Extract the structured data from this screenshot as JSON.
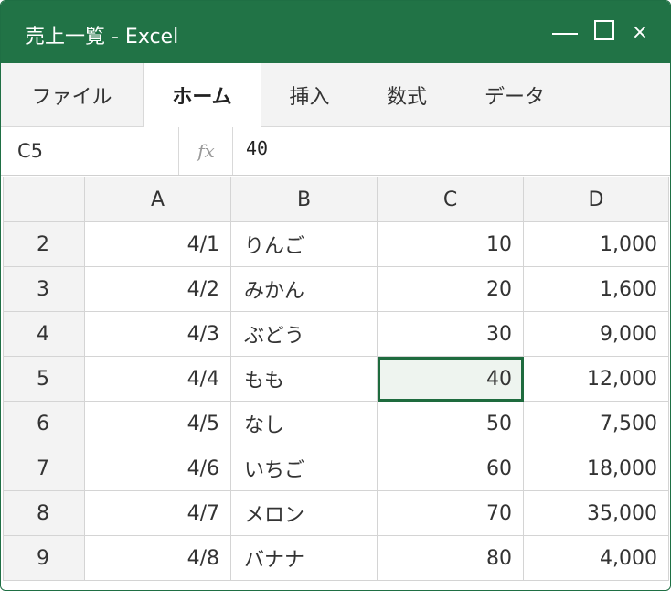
{
  "window": {
    "title": "売上一覧 - Excel",
    "accent_color": "#217346",
    "minimize_icon": "minimize-icon",
    "maximize_icon": "maximize-icon",
    "close_icon": "close-icon",
    "close_glyph": "×"
  },
  "ribbon": {
    "tabs": [
      {
        "label": "ファイル",
        "active": false
      },
      {
        "label": "ホーム",
        "active": true
      },
      {
        "label": "挿入",
        "active": false
      },
      {
        "label": "数式",
        "active": false
      },
      {
        "label": "データ",
        "active": false
      }
    ]
  },
  "formula_bar": {
    "name_box": "C5",
    "fx_label": "fx",
    "value": "40"
  },
  "sheet": {
    "columns": [
      "A",
      "B",
      "C",
      "D"
    ],
    "selected_cell": "C5",
    "rows": [
      {
        "row": "2",
        "a": "4/1",
        "b": "りんご",
        "c": "10",
        "d": "1,000"
      },
      {
        "row": "3",
        "a": "4/2",
        "b": "みかん",
        "c": "20",
        "d": "1,600"
      },
      {
        "row": "4",
        "a": "4/3",
        "b": "ぶどう",
        "c": "30",
        "d": "9,000"
      },
      {
        "row": "5",
        "a": "4/4",
        "b": "もも",
        "c": "40",
        "d": "12,000"
      },
      {
        "row": "6",
        "a": "4/5",
        "b": "なし",
        "c": "50",
        "d": "7,500"
      },
      {
        "row": "7",
        "a": "4/6",
        "b": "いちご",
        "c": "60",
        "d": "18,000"
      },
      {
        "row": "8",
        "a": "4/7",
        "b": "メロン",
        "c": "70",
        "d": "35,000"
      },
      {
        "row": "9",
        "a": "4/8",
        "b": "バナナ",
        "c": "80",
        "d": "4,000"
      }
    ]
  }
}
